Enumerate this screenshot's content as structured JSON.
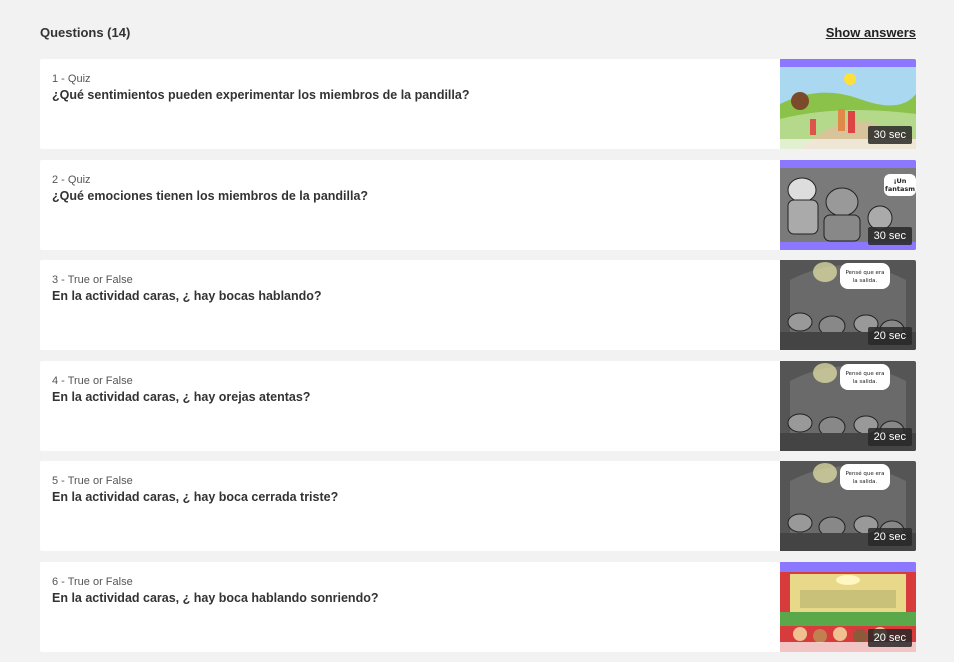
{
  "header": {
    "title": "Questions (14)",
    "show_answers": "Show answers"
  },
  "questions": [
    {
      "meta": "1 - Quiz",
      "text": "¿Qué sentimientos pueden experimentar los miembros de la pandilla?",
      "duration": "30 sec",
      "thumb": "countryside"
    },
    {
      "meta": "2 - Quiz",
      "text": "¿Qué emociones tienen los miembros de la pandilla?",
      "duration": "30 sec",
      "thumb": "gang",
      "bubble": "¡Un fantasm"
    },
    {
      "meta": "3 - True or False",
      "text": "En la actividad caras, ¿ hay bocas hablando?",
      "duration": "20 sec",
      "thumb": "theater-gray",
      "bubble": "Pensé que era la salida."
    },
    {
      "meta": "4 - True or False",
      "text": "En la actividad caras, ¿ hay orejas atentas?",
      "duration": "20 sec",
      "thumb": "theater-gray",
      "bubble": "Pensé que era la salida."
    },
    {
      "meta": "5 - True or False",
      "text": "En la actividad caras, ¿ hay boca cerrada triste?",
      "duration": "20 sec",
      "thumb": "theater-gray",
      "bubble": "Pensé que era la salida."
    },
    {
      "meta": "6 - True or False",
      "text": "En la actividad caras, ¿ hay boca hablando sonriendo?",
      "duration": "20 sec",
      "thumb": "theater-color"
    }
  ]
}
